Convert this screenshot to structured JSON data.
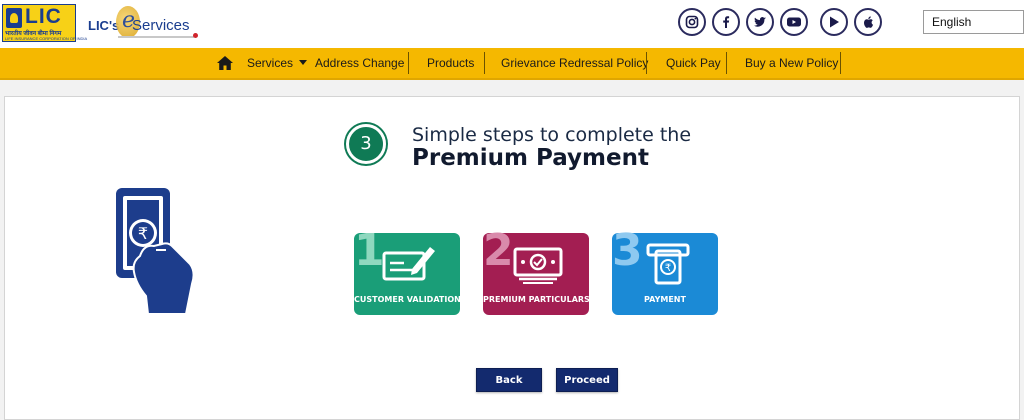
{
  "header": {
    "logo": {
      "name": "LIC",
      "hindi": "भारतीय जीवन बीमा निगम",
      "sub": "LIFE INSURANCE CORPORATION OF INDIA"
    },
    "eservices": {
      "prefix": "LIC's",
      "e": "e",
      "label": "Services"
    },
    "social_icons": [
      "instagram-icon",
      "facebook-icon",
      "twitter-icon",
      "youtube-icon",
      "play-store-icon",
      "apple-icon"
    ],
    "language": {
      "selected": "English"
    }
  },
  "nav": {
    "items": [
      {
        "label": "Services",
        "has_dropdown": true
      },
      {
        "label": "Address Change"
      },
      {
        "label": "Products"
      },
      {
        "label": "Grievance Redressal Policy"
      },
      {
        "label": "Quick Pay"
      },
      {
        "label": "Buy a New Policy"
      }
    ]
  },
  "main": {
    "step_number": "3",
    "heading_line1": "Simple steps to complete the",
    "heading_line2": "Premium Payment",
    "steps": [
      {
        "number": "1",
        "label": "CUSTOMER VALIDATION",
        "color": "#1a9e78",
        "icon": "form-icon"
      },
      {
        "number": "2",
        "label": "PREMIUM PARTICULARS",
        "color": "#a31e52",
        "icon": "banknote-icon"
      },
      {
        "number": "3",
        "label": "PAYMENT",
        "color": "#1b8ad6",
        "icon": "atm-icon"
      }
    ],
    "buttons": {
      "back": "Back",
      "proceed": "Proceed"
    }
  },
  "colors": {
    "navbar": "#f5b800",
    "brand_blue": "#1a3d8f",
    "button": "#132a6e"
  }
}
